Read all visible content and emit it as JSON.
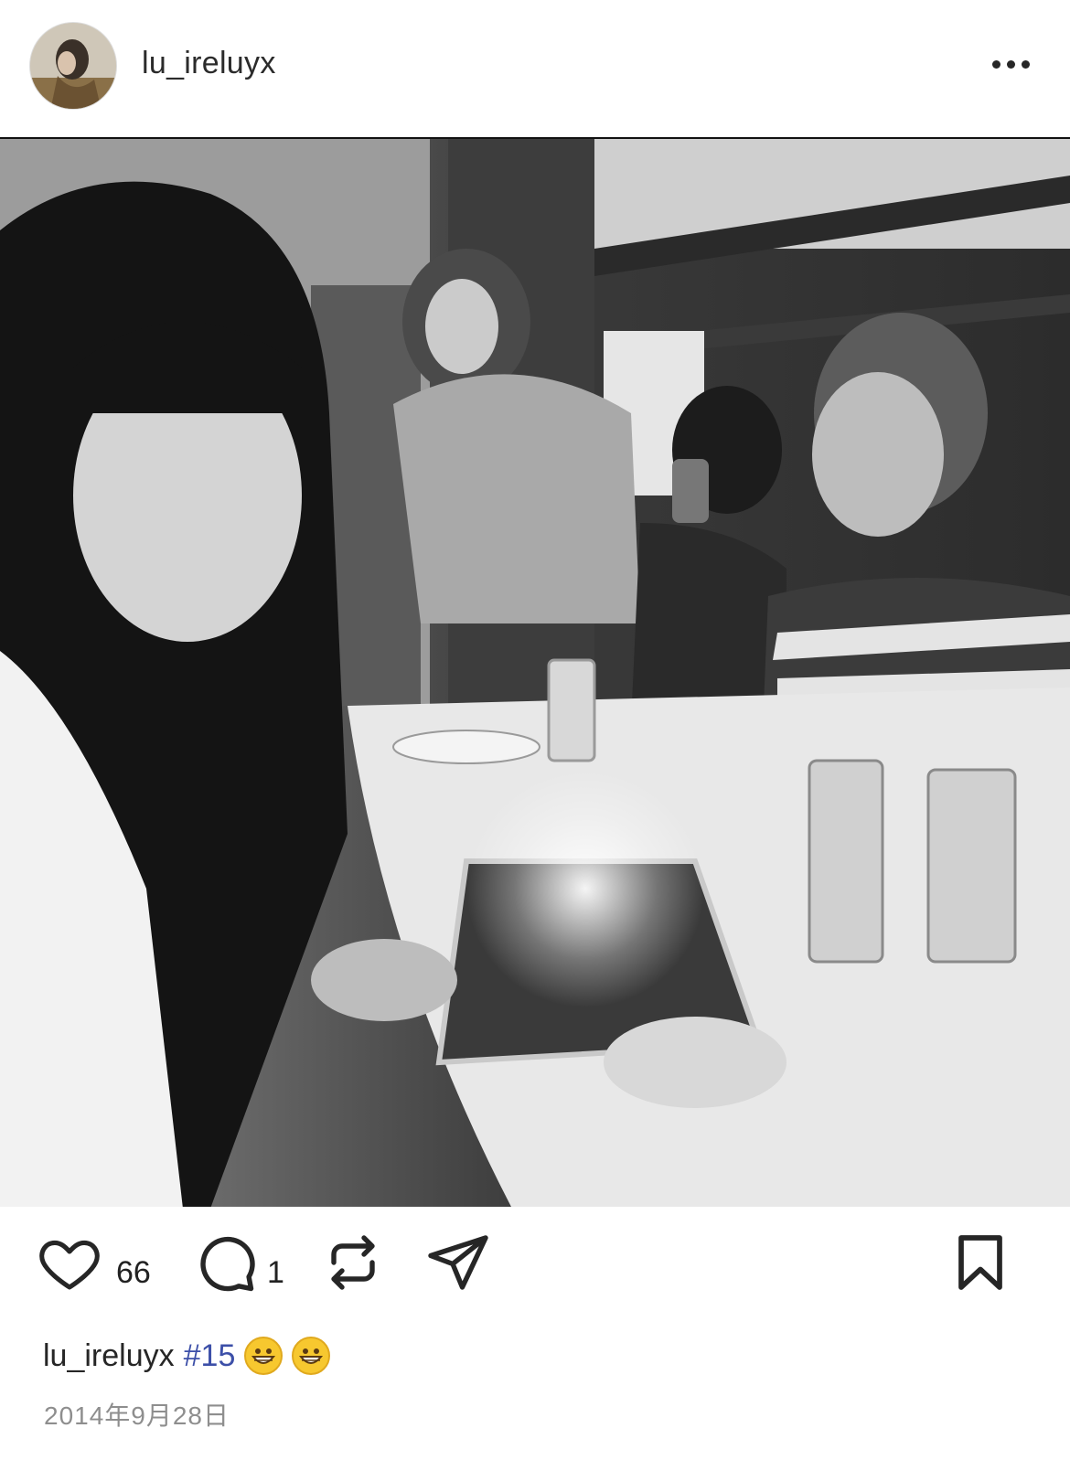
{
  "post": {
    "username": "lu_ireluyx",
    "avatar_icon": "profile-avatar",
    "more_icon": "more-options-icon",
    "photo_description_icon": "group-photo",
    "likes": "66",
    "comments": "1",
    "caption_user": "lu_ireluyx",
    "caption_tag": "#15",
    "caption_emojis": [
      "grinning-face-emoji",
      "grinning-face-emoji"
    ],
    "date": "2014年9月28日"
  },
  "colors": {
    "hashtag": "#3c4fa8",
    "date": "#8e8e8e",
    "icon": "#262626"
  }
}
